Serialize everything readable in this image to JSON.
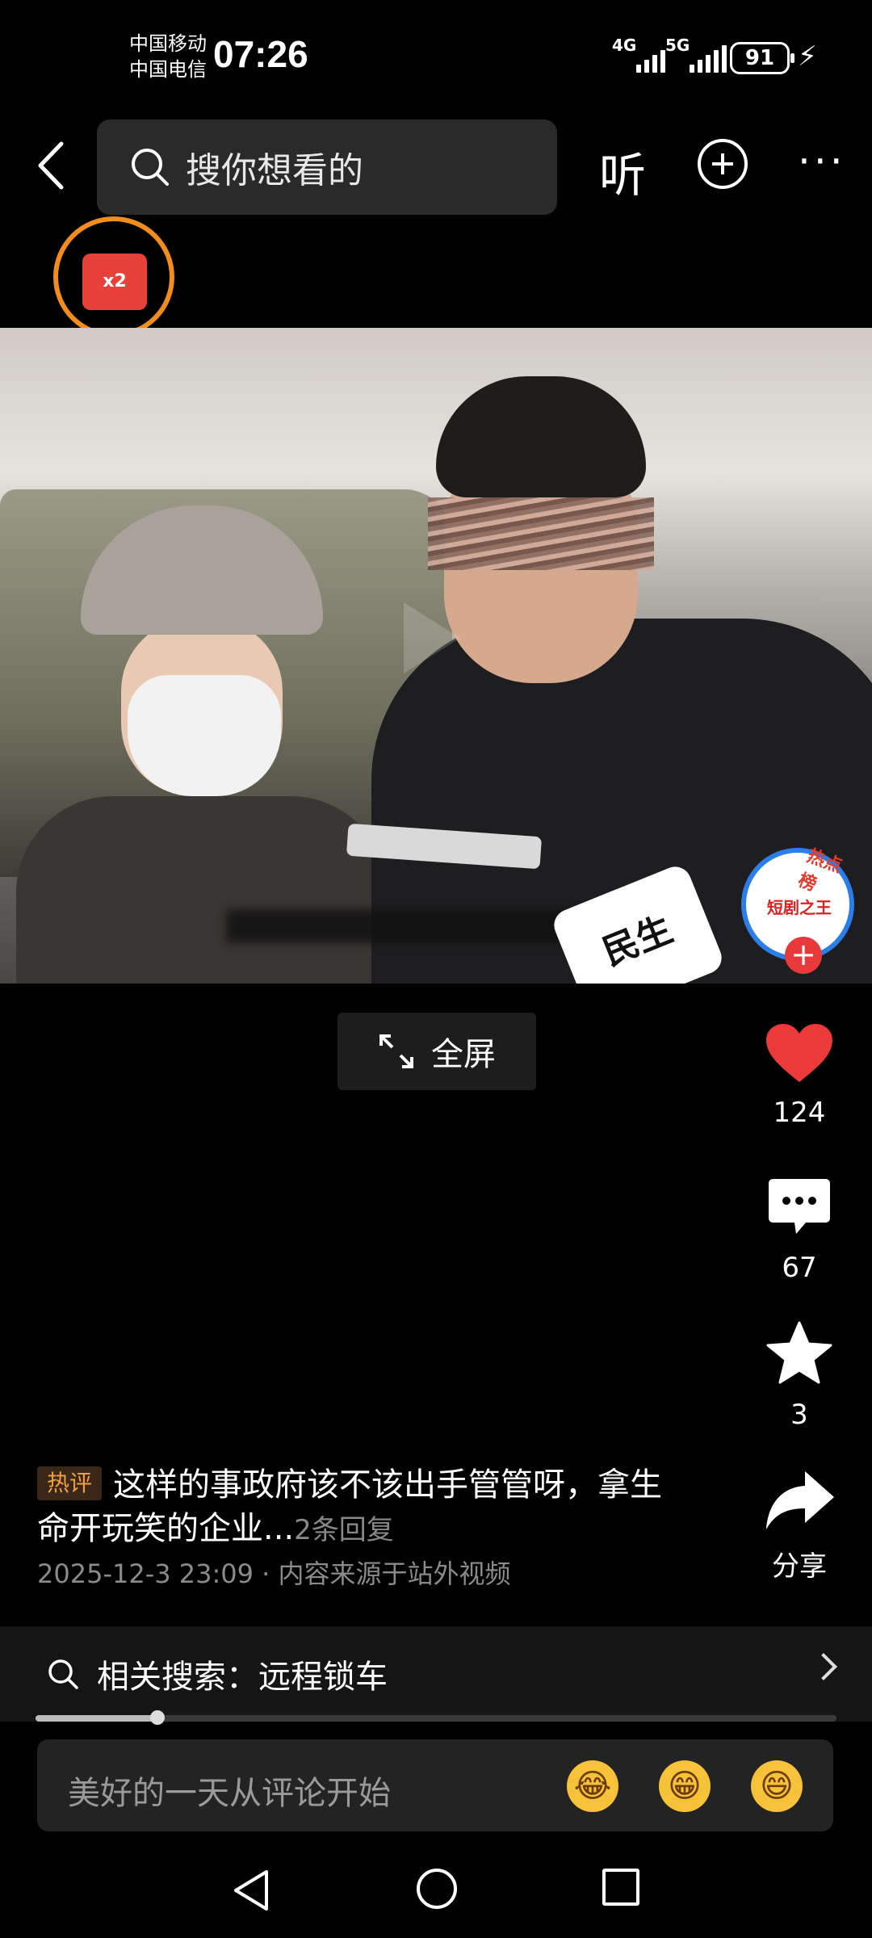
{
  "status_bar": {
    "carrier_1": "中国移动",
    "carrier_2": "中国电信",
    "time": "07:26",
    "network_1": "4G",
    "network_2": "5G",
    "battery": "91"
  },
  "top_bar": {
    "search_placeholder": "搜你想看的",
    "listen_label": "听"
  },
  "red_packet": {
    "multiplier": "x2"
  },
  "video": {
    "mic_text": "民生",
    "hot_badge_top": "热点榜",
    "hot_badge_mid": "短剧之王"
  },
  "fullscreen": {
    "label": "全屏"
  },
  "actions": {
    "likes": "124",
    "comments": "67",
    "favorites": "3",
    "share_label": "分享"
  },
  "hot_comment": {
    "tag": "热评",
    "text": "这样的事政府该不该出手管管呀，拿生命开玩笑的企业...",
    "reply_count": "2条回复",
    "meta": "2025-12-3 23:09 · 内容来源于站外视频"
  },
  "related_search": {
    "label": "相关搜索：远程锁车"
  },
  "progress": {
    "fraction": 0.152
  },
  "comment_input": {
    "placeholder": "美好的一天从评论开始",
    "emoji_1": "😂",
    "emoji_2": "😁",
    "emoji_3": "😄"
  },
  "colors": {
    "accent_orange": "#f28c1b",
    "like_red": "#ea3a3a",
    "hot_tag": "#f0a040"
  }
}
